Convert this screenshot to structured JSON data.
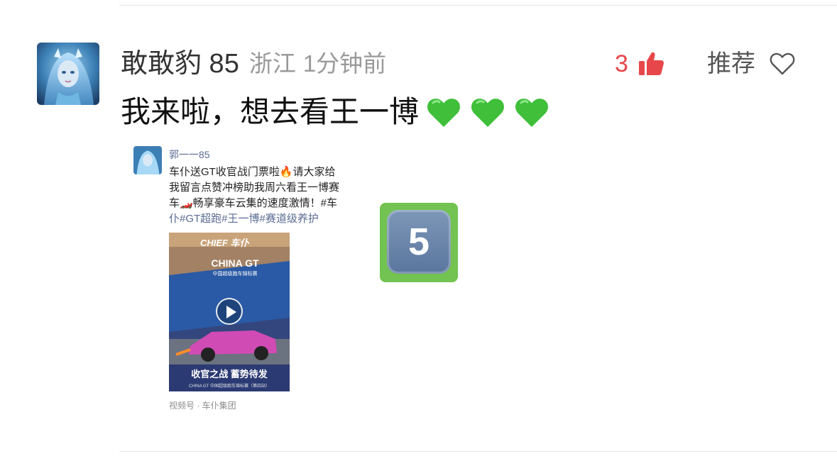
{
  "comment": {
    "username": "敢敢豹 85",
    "location": "浙江",
    "time": "1分钟前",
    "like_count": "3",
    "recommend_label": "推荐",
    "text": "我来啦，想去看王一博",
    "emoji": [
      "💚",
      "💚",
      "💚"
    ],
    "icons": {
      "avatar": "fantasy-character-avatar",
      "like": "thumbs-up-icon",
      "recommend": "heart-outline-icon"
    }
  },
  "attached_screenshot": {
    "name": "郭一一85",
    "body_lines": [
      "车仆送GT收官战门票啦🔥请大家给",
      "我留言点赞冲榜助我周六看王一博赛",
      "车🏎️畅享豪车云集的速度激情！#车",
      "仆#GT超跑#王一博#赛道级养护"
    ],
    "video": {
      "brand": "CHIEF 车仆",
      "banner_line1": "CHINA GT",
      "banner_line2": "中国超级跑车锦标赛",
      "caption_big": "收官之战 蓄势待发",
      "caption_small": "CHINA GT 中国超级跑车锦标赛（第四站）"
    },
    "source": "视频号 · 车仆集团"
  },
  "keycap": {
    "number": "5"
  },
  "colors": {
    "like_red": "#e7474a",
    "meta_gray": "#9a9a9a",
    "link_blue": "#5b6b93",
    "keycap_green": "#72c351"
  }
}
